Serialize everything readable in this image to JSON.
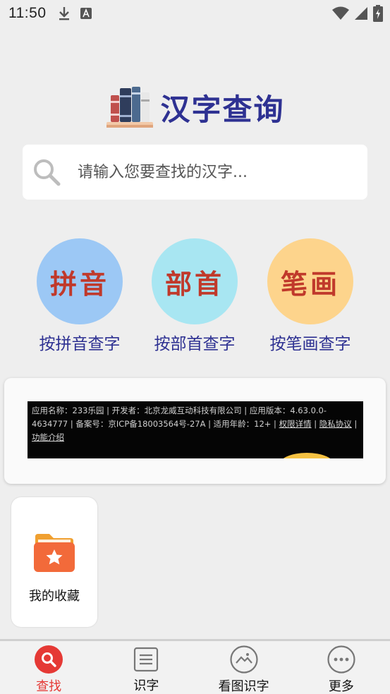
{
  "status_bar": {
    "time": "11:50"
  },
  "header": {
    "title": "汉字查询",
    "logo_icon": "books-icon"
  },
  "search": {
    "placeholder": "请输入您要查找的汉字..."
  },
  "lookup": [
    {
      "id": "pinyin",
      "circle_text": "拼音",
      "label": "按拼音查字",
      "circle_color": "#9cc8f5"
    },
    {
      "id": "radical",
      "circle_text": "部首",
      "label": "按部首查字",
      "circle_color": "#a8e6f2"
    },
    {
      "id": "stroke",
      "circle_text": "笔画",
      "label": "按笔画查字",
      "circle_color": "#fdd48c"
    }
  ],
  "ad": {
    "text": "应用名称：233乐园 | 开发者：北京龙威互动科技有限公司 | 应用版本：4.63.0.0-4634777 | 备案号：京ICP备18003564号-27A | 适用年龄：12+ | ",
    "links": [
      "权限详情",
      "隐私协议",
      "功能介绍"
    ],
    "separator": " | "
  },
  "favorites": {
    "label": "我的收藏",
    "icon": "star-folder-icon"
  },
  "bottom_nav": [
    {
      "id": "search",
      "label": "查找",
      "icon": "search-icon",
      "active": true
    },
    {
      "id": "learn",
      "label": "识字",
      "icon": "document-icon",
      "active": false
    },
    {
      "id": "image",
      "label": "看图识字",
      "icon": "image-icon",
      "active": false
    },
    {
      "id": "more",
      "label": "更多",
      "icon": "more-icon",
      "active": false
    }
  ],
  "colors": {
    "accent": "#2e3192",
    "active_tab": "#e53935",
    "background": "#eeeeee"
  }
}
